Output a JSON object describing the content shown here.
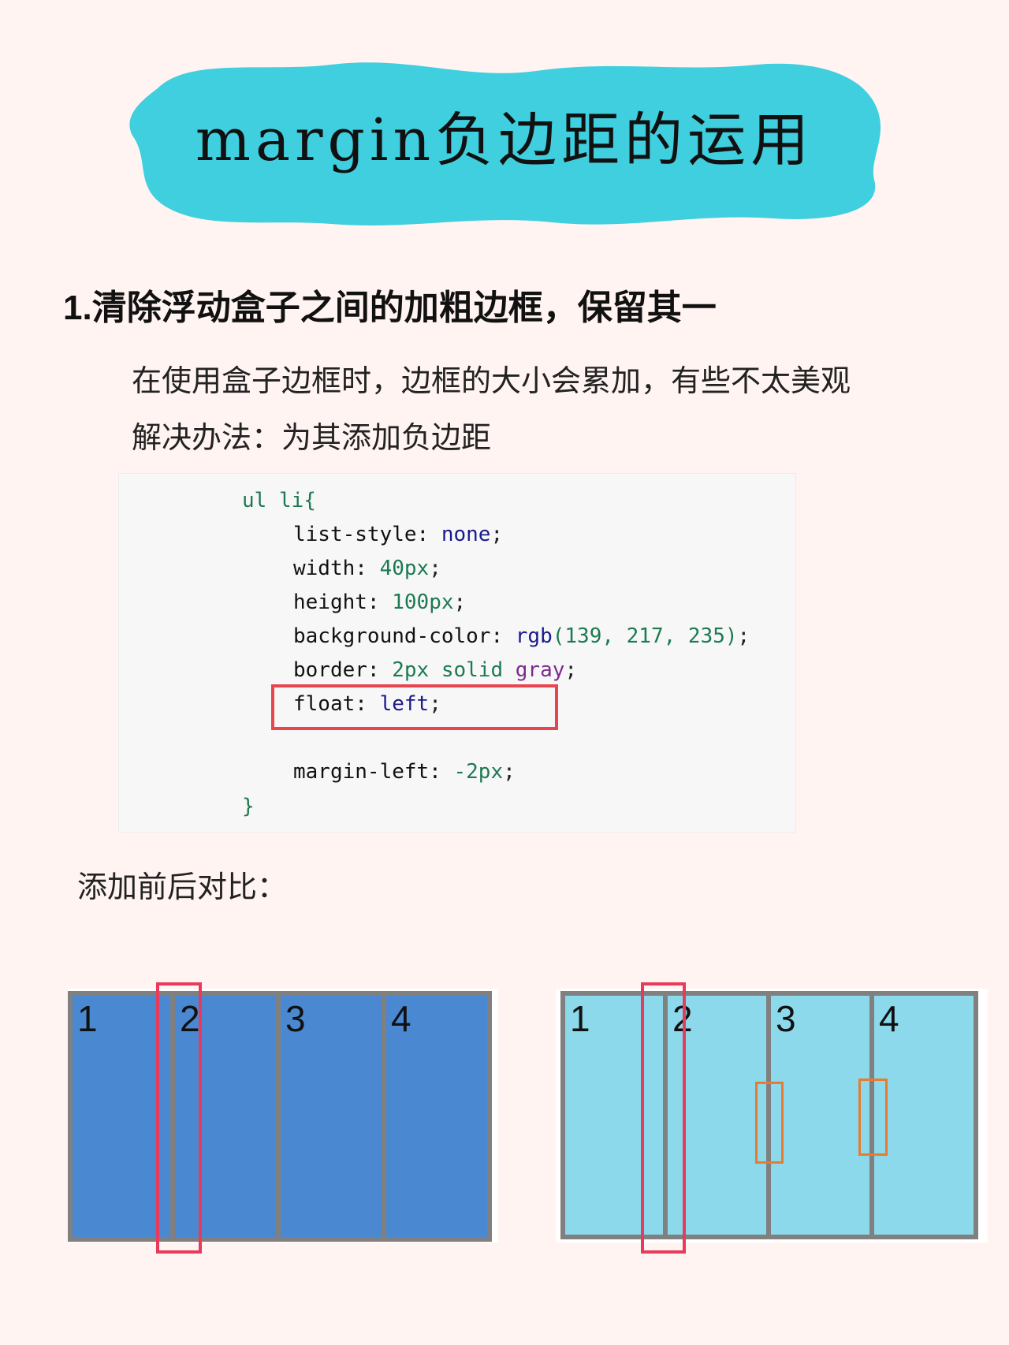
{
  "title": "margin负边距的运用",
  "heading": "1.清除浮动盒子之间的加粗边框，保留其一",
  "paragraph1": "在使用盒子边框时，边框的大小会累加，有些不太美观",
  "paragraph2": "解决办法：为其添加负边距",
  "code": {
    "selector": "ul li{",
    "line1_prop": "list-style:",
    "line1_val": " none",
    "line1_end": ";",
    "line2_prop": "width:",
    "line2_val": " 40px",
    "line2_end": ";",
    "line3_prop": "height:",
    "line3_val": " 100px",
    "line3_end": ";",
    "line4_prop": "background-color:",
    "line4_fn": " rgb",
    "line4_args": "(139, 217, 235)",
    "line4_end": ";",
    "line5_prop": "border:",
    "line5_val": " 2px solid",
    "line5_color": " gray",
    "line5_end": ";",
    "line6_prop": "float:",
    "line6_val": " left",
    "line6_end": ";",
    "line7_prop": "margin-left:",
    "line7_val": " -2px",
    "line7_end": ";",
    "close": "}"
  },
  "compare_label": "添加前后对比：",
  "demo_before": {
    "items": [
      "1",
      "2",
      "3",
      "4"
    ],
    "fill_color": "#4a88d2"
  },
  "demo_after": {
    "items": [
      "1",
      "2",
      "3",
      "4"
    ],
    "fill_color": "#8bd9eb"
  },
  "colors": {
    "banner": "#3fcfdf",
    "highlight_red": "#e8454f",
    "border_gray": "#808080",
    "orange": "#e87b2e"
  }
}
